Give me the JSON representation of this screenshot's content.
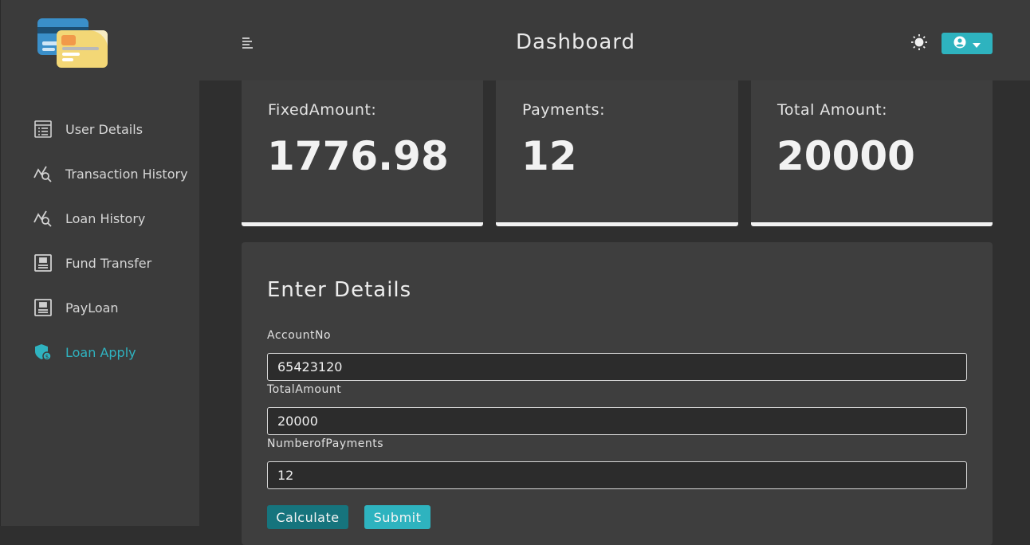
{
  "header": {
    "title": "Dashboard"
  },
  "sidebar": {
    "items": [
      {
        "label": "User Details",
        "icon": "list-icon",
        "active": false
      },
      {
        "label": "Transaction History",
        "icon": "chart-search-icon",
        "active": false
      },
      {
        "label": "Loan History",
        "icon": "chart-search-icon",
        "active": false
      },
      {
        "label": "Fund Transfer",
        "icon": "document-icon",
        "active": false
      },
      {
        "label": "PayLoan",
        "icon": "document-icon",
        "active": false
      },
      {
        "label": "Loan Apply",
        "icon": "shield-icon",
        "active": true
      }
    ]
  },
  "cards": [
    {
      "label": "FixedAmount:",
      "value": "1776.98"
    },
    {
      "label": "Payments:",
      "value": "12"
    },
    {
      "label": "Total Amount:",
      "value": "20000"
    }
  ],
  "form": {
    "title": "Enter Details",
    "fields": [
      {
        "label": "AccountNo",
        "value": "65423120"
      },
      {
        "label": "TotalAmount",
        "value": "20000"
      },
      {
        "label": "NumberofPayments",
        "value": "12"
      }
    ],
    "calculate_label": "Calculate",
    "submit_label": "Submit"
  },
  "colors": {
    "accent": "#2eb3bf",
    "accent_dark": "#16747d",
    "sidebar_bg": "#3b3b3b",
    "page_bg": "#2f2f2f"
  }
}
